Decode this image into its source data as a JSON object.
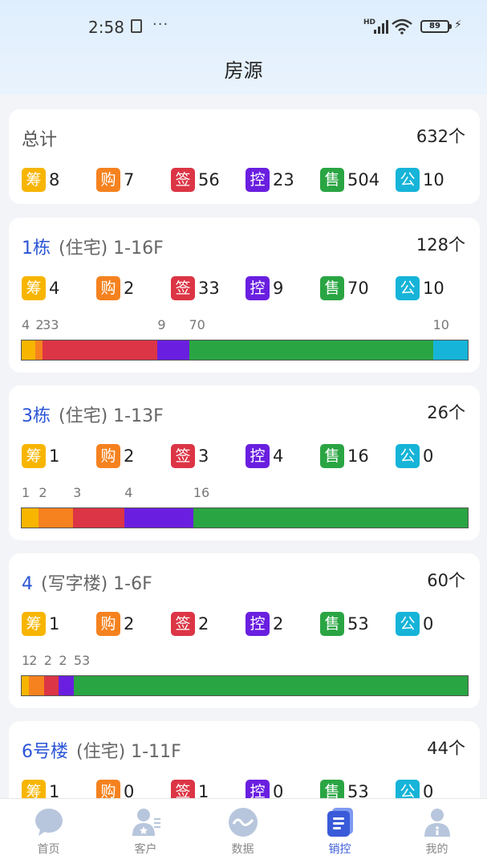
{
  "status_bar": {
    "time": "2:58",
    "dots": "···",
    "hd": "HD",
    "battery": "89"
  },
  "header": {
    "title": "房源"
  },
  "summary": {
    "name": "总计",
    "total": "632个",
    "stats": [
      {
        "label": "筹",
        "value": "8"
      },
      {
        "label": "购",
        "value": "7"
      },
      {
        "label": "签",
        "value": "56"
      },
      {
        "label": "控",
        "value": "23"
      },
      {
        "label": "售",
        "value": "504"
      },
      {
        "label": "公",
        "value": "10"
      }
    ]
  },
  "colors": {
    "筹": "#f7b500",
    "购": "#f5821f",
    "签": "#dc3545",
    "控": "#6a1fe0",
    "售": "#2aa543",
    "公": "#16b4d8",
    "empty": "#f1f1f1"
  },
  "buildings": [
    {
      "name": "1栋",
      "type": "(住宅) 1-16F",
      "total": "128个",
      "stats": [
        {
          "label": "筹",
          "value": "4"
        },
        {
          "label": "购",
          "value": "2"
        },
        {
          "label": "签",
          "value": "33"
        },
        {
          "label": "控",
          "value": "9"
        },
        {
          "label": "售",
          "value": "70"
        },
        {
          "label": "公",
          "value": "10"
        }
      ],
      "bar_labels": [
        "4",
        "2",
        "33",
        "9",
        "70",
        "10"
      ]
    },
    {
      "name": "3栋",
      "type": "(住宅) 1-13F",
      "total": "26个",
      "stats": [
        {
          "label": "筹",
          "value": "1"
        },
        {
          "label": "购",
          "value": "2"
        },
        {
          "label": "签",
          "value": "3"
        },
        {
          "label": "控",
          "value": "4"
        },
        {
          "label": "售",
          "value": "16"
        },
        {
          "label": "公",
          "value": "0"
        }
      ],
      "bar_labels": [
        "1",
        "2",
        "3",
        "4",
        "16"
      ]
    },
    {
      "name": "4",
      "type": "(写字楼) 1-6F",
      "total": "60个",
      "stats": [
        {
          "label": "筹",
          "value": "1"
        },
        {
          "label": "购",
          "value": "2"
        },
        {
          "label": "签",
          "value": "2"
        },
        {
          "label": "控",
          "value": "2"
        },
        {
          "label": "售",
          "value": "53"
        },
        {
          "label": "公",
          "value": "0"
        }
      ],
      "bar_labels": [
        "1",
        "2",
        "2",
        "2",
        "53"
      ]
    },
    {
      "name": "6号楼",
      "type": "(住宅) 1-11F",
      "total": "44个",
      "stats": [
        {
          "label": "筹",
          "value": "1"
        },
        {
          "label": "购",
          "value": "0"
        },
        {
          "label": "签",
          "value": "1"
        },
        {
          "label": "控",
          "value": "0"
        },
        {
          "label": "售",
          "value": "53"
        },
        {
          "label": "公",
          "value": "0"
        }
      ],
      "bar_labels": []
    }
  ],
  "tabs": [
    {
      "label": "首页",
      "icon": "chat-bubble-icon",
      "active": false
    },
    {
      "label": "客户",
      "icon": "customer-icon",
      "active": false
    },
    {
      "label": "数据",
      "icon": "data-wave-icon",
      "active": false
    },
    {
      "label": "销控",
      "icon": "sales-control-icon",
      "active": true
    },
    {
      "label": "我的",
      "icon": "profile-icon",
      "active": false
    }
  ]
}
